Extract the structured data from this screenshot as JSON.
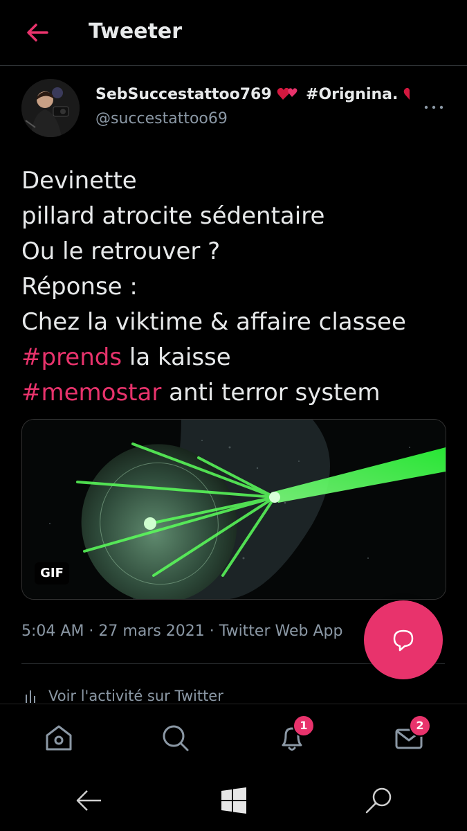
{
  "header": {
    "title": "Tweeter",
    "back_icon": "back-arrow-icon"
  },
  "tweet": {
    "author": {
      "display_name": "SebSuccestattoo769",
      "display_name_suffix": "#Orignina.",
      "handle": "@succestattoo69"
    },
    "text_lines": [
      "Devinette",
      "pillard atrocite sédentaire",
      "Ou le retrouver ?",
      "Réponse :",
      "Chez la viktime & affaire classee"
    ],
    "hashtag_lines": [
      {
        "tag": "#prends",
        "rest": " la kaisse"
      },
      {
        "tag": "#memostar",
        "rest": " anti terror system"
      }
    ],
    "media_badge": "GIF",
    "meta": "5:04 AM · 27 mars 2021 · Twitter Web App",
    "activity": "Voir l'activité sur Twitter"
  },
  "nav": {
    "notifications_badge": "1",
    "messages_badge": "2"
  },
  "colors": {
    "accent": "#e8336c",
    "background": "#000000",
    "secondary_text": "#8b98a5"
  }
}
